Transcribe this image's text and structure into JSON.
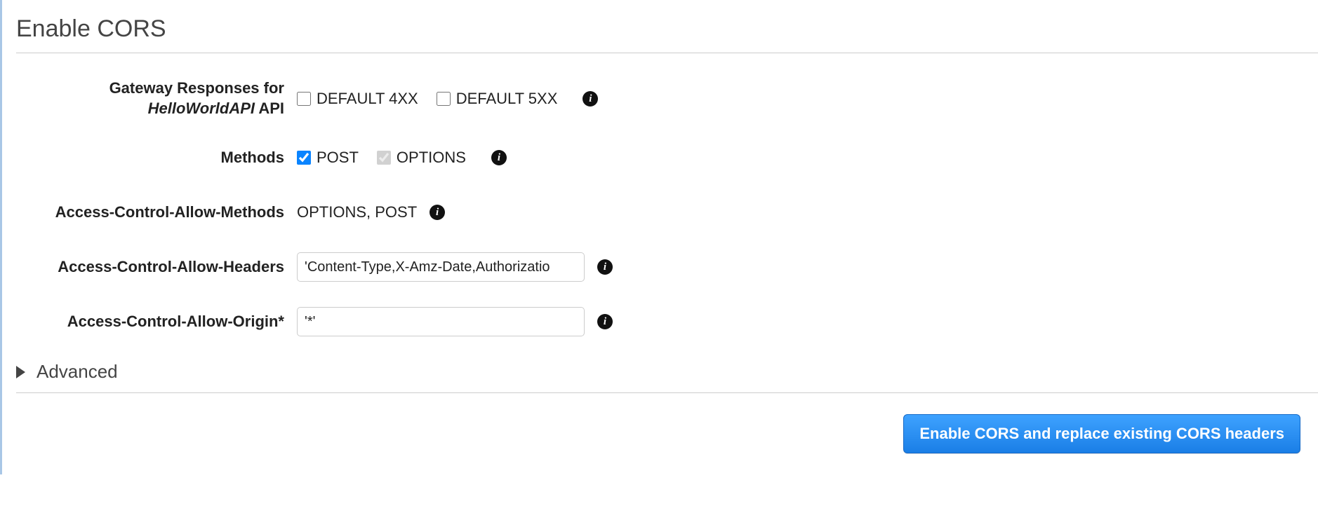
{
  "title": "Enable CORS",
  "gatewayResponses": {
    "labelPrefix": "Gateway Responses for",
    "apiName": "HelloWorldAPI",
    "labelSuffix": "API",
    "default4xx": {
      "label": "DEFAULT 4XX",
      "checked": false
    },
    "default5xx": {
      "label": "DEFAULT 5XX",
      "checked": false
    }
  },
  "methods": {
    "label": "Methods",
    "post": {
      "label": "POST",
      "checked": true
    },
    "options": {
      "label": "OPTIONS",
      "checked": true,
      "disabled": true
    }
  },
  "allowMethods": {
    "label": "Access-Control-Allow-Methods",
    "value": "OPTIONS, POST"
  },
  "allowHeaders": {
    "label": "Access-Control-Allow-Headers",
    "value": "'Content-Type,X-Amz-Date,Authorizatio"
  },
  "allowOrigin": {
    "label": "Access-Control-Allow-Origin*",
    "value": "'*'"
  },
  "advanced": "Advanced",
  "submit": "Enable CORS and replace existing CORS headers"
}
